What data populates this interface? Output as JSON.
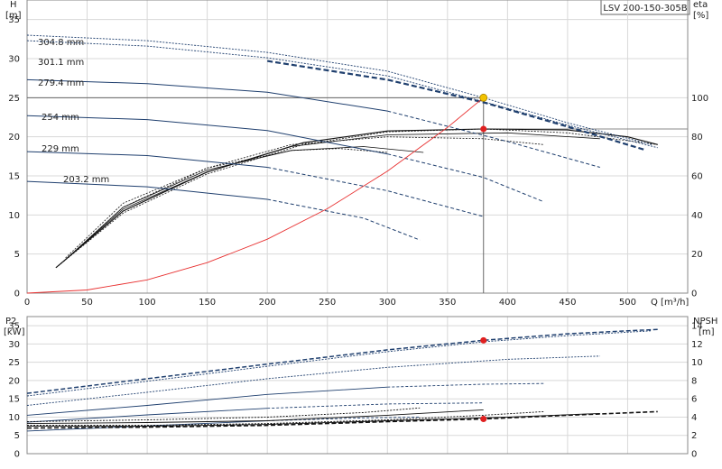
{
  "chart_data": [
    {
      "type": "line",
      "title": "LSV 200-150-305B",
      "xlabel": "Q [m³/h]",
      "ylabel_left": "H\n[m]",
      "ylabel_right": "eta\n[%]",
      "xlim": [
        0,
        550
      ],
      "ylim_left": [
        0,
        37.5
      ],
      "ylim_right": [
        0,
        150
      ],
      "x_ticks": [
        0,
        50,
        100,
        150,
        200,
        250,
        300,
        350,
        400,
        450,
        500
      ],
      "y_left_ticks": [
        0,
        5,
        10,
        15,
        20,
        25,
        30,
        35
      ],
      "y_right_ticks": [
        0,
        20,
        40,
        60,
        80,
        100
      ],
      "grid": true,
      "impeller_curves": [
        {
          "name": "304.8 mm",
          "points": [
            [
              0,
              33.0
            ],
            [
              100,
              32.3
            ],
            [
              200,
              30.8
            ],
            [
              300,
              28.4
            ],
            [
              380,
              25.0
            ],
            [
              450,
              21.8
            ],
            [
              520,
              19.0
            ]
          ],
          "dash_segment": [
            [
              200,
              29.7
            ],
            [
              300,
              27.3
            ],
            [
              380,
              24.4
            ],
            [
              450,
              21.3
            ],
            [
              515,
              18.3
            ]
          ]
        },
        {
          "name": "301.1 mm",
          "points": [
            [
              0,
              32.3
            ],
            [
              100,
              31.6
            ],
            [
              200,
              30.1
            ],
            [
              300,
              27.8
            ],
            [
              380,
              24.5
            ],
            [
              450,
              21.5
            ],
            [
              525,
              18.6
            ]
          ]
        },
        {
          "name": "279.4 mm",
          "points": [
            [
              0,
              27.3
            ],
            [
              100,
              26.8
            ],
            [
              200,
              25.7
            ],
            [
              300,
              23.3
            ],
            [
              400,
              19.4
            ],
            [
              477,
              16.1
            ]
          ]
        },
        {
          "name": "254 mm",
          "points": [
            [
              0,
              22.7
            ],
            [
              100,
              22.2
            ],
            [
              200,
              20.8
            ],
            [
              300,
              17.8
            ],
            [
              380,
              14.8
            ],
            [
              430,
              11.7
            ]
          ]
        },
        {
          "name": "229 mm",
          "points": [
            [
              0,
              18.1
            ],
            [
              100,
              17.6
            ],
            [
              200,
              16.1
            ],
            [
              300,
              13.1
            ],
            [
              380,
              9.8
            ]
          ]
        },
        {
          "name": "203.2 mm",
          "points": [
            [
              0,
              14.3
            ],
            [
              100,
              13.6
            ],
            [
              200,
              12.0
            ],
            [
              280,
              9.6
            ],
            [
              327,
              6.8
            ]
          ]
        }
      ],
      "efficiency_curves": [
        {
          "name": "304.8 mm",
          "points": [
            [
              24,
              13
            ],
            [
              80,
              42
            ],
            [
              150,
              62
            ],
            [
              230,
              77
            ],
            [
              300,
              83
            ],
            [
              380,
              84
            ],
            [
              450,
              83.5
            ],
            [
              500,
              80
            ],
            [
              525,
              76
            ]
          ]
        },
        {
          "name": "301.1 mm",
          "points": [
            [
              24,
              13
            ],
            [
              80,
              41
            ],
            [
              150,
              61
            ],
            [
              230,
              76
            ],
            [
              300,
              82.5
            ],
            [
              380,
              84
            ],
            [
              450,
              82
            ],
            [
              525,
              76
            ]
          ]
        },
        {
          "name": "279.4 mm",
          "points": [
            [
              26,
              14
            ],
            [
              80,
              43
            ],
            [
              150,
              62
            ],
            [
              220,
              75
            ],
            [
              300,
              81
            ],
            [
              400,
              82
            ],
            [
              477,
              79
            ]
          ]
        },
        {
          "name": "254 mm",
          "points": [
            [
              28,
              15
            ],
            [
              80,
              44
            ],
            [
              150,
              64
            ],
            [
              220,
              76
            ],
            [
              300,
              80
            ],
            [
              380,
              79
            ],
            [
              430,
              76
            ]
          ]
        },
        {
          "name": "229 mm",
          "points": [
            [
              30,
              16
            ],
            [
              80,
              44
            ],
            [
              150,
              63
            ],
            [
              220,
              73
            ],
            [
              280,
              75
            ],
            [
              330,
              72
            ]
          ]
        },
        {
          "name": "203.2 mm",
          "points": [
            [
              32,
              18
            ],
            [
              80,
              46
            ],
            [
              150,
              64
            ],
            [
              220,
              73
            ],
            [
              260,
              74
            ],
            [
              300,
              72
            ]
          ]
        }
      ],
      "system_curve": {
        "points": [
          [
            0,
            0
          ],
          [
            50,
            0.4
          ],
          [
            100,
            1.7
          ],
          [
            150,
            3.9
          ],
          [
            200,
            6.9
          ],
          [
            250,
            10.8
          ],
          [
            300,
            15.6
          ],
          [
            350,
            21.2
          ],
          [
            380,
            25.0
          ]
        ]
      },
      "duty_point": {
        "Q": 380,
        "H": 25.0,
        "eta": 84
      }
    },
    {
      "type": "line",
      "xlabel": "",
      "ylabel_left": "P2\n[kW]",
      "ylabel_right": "NPSH\n[m]",
      "xlim": [
        0,
        550
      ],
      "ylim_left": [
        0,
        37.5
      ],
      "ylim_right": [
        0,
        15
      ],
      "y_left_ticks": [
        0,
        5,
        10,
        15,
        20,
        25,
        30,
        35
      ],
      "y_right_ticks": [
        0,
        2,
        4,
        6,
        8,
        10,
        12,
        14
      ],
      "power_curves": [
        {
          "name": "304.8 mm",
          "points": [
            [
              0,
              16.5
            ],
            [
              100,
              20.5
            ],
            [
              200,
              24.5
            ],
            [
              300,
              28.4
            ],
            [
              380,
              31.0
            ],
            [
              450,
              32.8
            ],
            [
              525,
              34.0
            ]
          ]
        },
        {
          "name": "301.1 mm",
          "points": [
            [
              0,
              15.8
            ],
            [
              100,
              19.8
            ],
            [
              200,
              23.9
            ],
            [
              300,
              27.9
            ],
            [
              380,
              30.6
            ],
            [
              450,
              32.3
            ],
            [
              520,
              33.6
            ]
          ]
        },
        {
          "name": "279.4 mm",
          "points": [
            [
              0,
              13.2
            ],
            [
              100,
              16.8
            ],
            [
              200,
              20.5
            ],
            [
              300,
              23.6
            ],
            [
              400,
              25.8
            ],
            [
              477,
              26.7
            ]
          ]
        },
        {
          "name": "254 mm",
          "points": [
            [
              0,
              10.5
            ],
            [
              100,
              13.2
            ],
            [
              200,
              16.2
            ],
            [
              300,
              18.2
            ],
            [
              380,
              19.0
            ],
            [
              430,
              19.2
            ]
          ]
        },
        {
          "name": "229 mm",
          "points": [
            [
              0,
              8.6
            ],
            [
              100,
              10.6
            ],
            [
              200,
              12.4
            ],
            [
              300,
              13.6
            ],
            [
              380,
              13.9
            ]
          ]
        },
        {
          "name": "203.2 mm",
          "points": [
            [
              0,
              6.2
            ],
            [
              100,
              7.6
            ],
            [
              200,
              9.0
            ],
            [
              280,
              9.8
            ],
            [
              327,
              10.0
            ]
          ]
        }
      ],
      "npsh_curves": [
        {
          "name": "304.8 mm",
          "points": [
            [
              0,
              2.8
            ],
            [
              100,
              2.9
            ],
            [
              200,
              3.1
            ],
            [
              300,
              3.5
            ],
            [
              380,
              3.8
            ],
            [
              450,
              4.2
            ],
            [
              525,
              4.6
            ]
          ]
        },
        {
          "name": "279.4 mm",
          "points": [
            [
              0,
              3.0
            ],
            [
              100,
              3.0
            ],
            [
              200,
              3.2
            ],
            [
              300,
              3.6
            ],
            [
              400,
              4.0
            ],
            [
              477,
              4.4
            ]
          ]
        },
        {
          "name": "254 mm",
          "points": [
            [
              0,
              3.1
            ],
            [
              100,
              3.1
            ],
            [
              200,
              3.3
            ],
            [
              300,
              3.7
            ],
            [
              380,
              4.2
            ],
            [
              430,
              4.6
            ]
          ]
        },
        {
          "name": "229 mm",
          "points": [
            [
              0,
              3.3
            ],
            [
              100,
              3.4
            ],
            [
              200,
              3.6
            ],
            [
              300,
              4.2
            ],
            [
              380,
              4.8
            ]
          ]
        },
        {
          "name": "203.2 mm",
          "points": [
            [
              0,
              3.5
            ],
            [
              100,
              3.7
            ],
            [
              200,
              4.0
            ],
            [
              280,
              4.5
            ],
            [
              327,
              5.0
            ]
          ]
        }
      ],
      "duty_point": {
        "Q": 380,
        "P2": 31.0,
        "NPSH": 3.8
      }
    }
  ],
  "colors": {
    "navy": "#1f3f6e",
    "red": "#e83030",
    "duty_yellow": "#f2c200",
    "duty_red": "#e02020",
    "black": "#111111",
    "grid": "#d8d8d8"
  }
}
